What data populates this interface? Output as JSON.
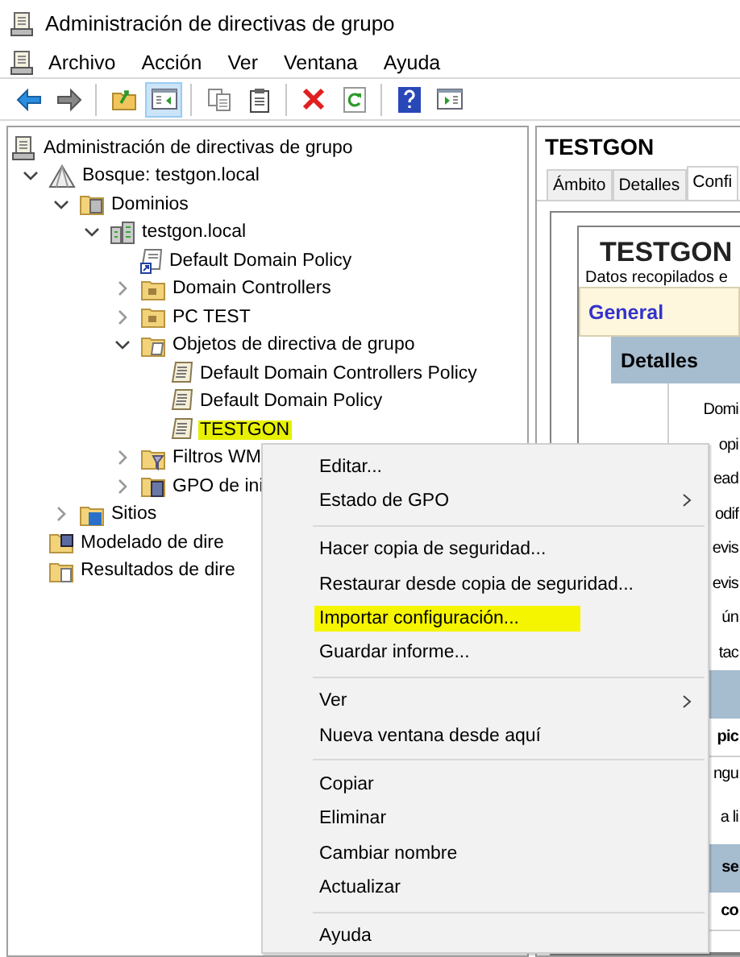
{
  "window": {
    "title": "Administración de directivas de grupo"
  },
  "menu_bar": [
    "Archivo",
    "Acción",
    "Ver",
    "Ventana",
    "Ayuda"
  ],
  "toolbar": [
    {
      "kind": "back",
      "pressed": false
    },
    {
      "kind": "forward",
      "pressed": false
    },
    {
      "kind": "separator"
    },
    {
      "kind": "up-folder",
      "pressed": false
    },
    {
      "kind": "tree-pane",
      "pressed": true
    },
    {
      "kind": "separator"
    },
    {
      "kind": "copy",
      "pressed": false
    },
    {
      "kind": "paste",
      "pressed": false
    },
    {
      "kind": "separator"
    },
    {
      "kind": "delete",
      "pressed": false
    },
    {
      "kind": "refresh",
      "pressed": false
    },
    {
      "kind": "separator"
    },
    {
      "kind": "help",
      "pressed": false
    },
    {
      "kind": "panel",
      "pressed": false
    }
  ],
  "tree": [
    {
      "label": "Administración de directivas de grupo",
      "kind": "console",
      "highlighted": false,
      "children": [
        {
          "label": "Bosque: testgon.local",
          "kind": "forest",
          "expanded": true,
          "highlighted": false,
          "children": [
            {
              "label": "Dominios",
              "kind": "domains",
              "expanded": true,
              "highlighted": false,
              "children": [
                {
                  "label": "testgon.local",
                  "kind": "domain",
                  "expanded": true,
                  "highlighted": false,
                  "children": [
                    {
                      "label": "Default Domain Policy",
                      "kind": "gpo-link",
                      "highlighted": false
                    },
                    {
                      "label": "Domain Controllers",
                      "kind": "ou",
                      "expanded": false,
                      "highlighted": false
                    },
                    {
                      "label": "PC TEST",
                      "kind": "ou",
                      "expanded": false,
                      "highlighted": false
                    },
                    {
                      "label": "Objetos de directiva de grupo",
                      "kind": "gpo-folder",
                      "expanded": true,
                      "highlighted": false,
                      "children": [
                        {
                          "label": "Default Domain Controllers Policy",
                          "kind": "gpo",
                          "highlighted": false
                        },
                        {
                          "label": "Default Domain Policy",
                          "kind": "gpo",
                          "highlighted": false
                        },
                        {
                          "label": "TESTGON",
                          "kind": "gpo",
                          "highlighted": true
                        }
                      ]
                    },
                    {
                      "label": "Filtros WM",
                      "kind": "wmi",
                      "expanded": false,
                      "highlighted": false
                    },
                    {
                      "label": "GPO de ini",
                      "kind": "starter",
                      "expanded": false,
                      "highlighted": false
                    }
                  ]
                }
              ]
            },
            {
              "label": "Sitios",
              "kind": "sites",
              "expanded": false,
              "highlighted": false
            }
          ]
        },
        {
          "label": "Modelado de dire",
          "kind": "modeling",
          "highlighted": false
        },
        {
          "label": "Resultados de dire",
          "kind": "results",
          "highlighted": false
        }
      ]
    }
  ],
  "details_pane": {
    "title": "TESTGON",
    "tabs": [
      {
        "label": "Ámbito",
        "selected": false
      },
      {
        "label": "Detalles",
        "selected": false
      },
      {
        "label": "Confi",
        "selected": true
      }
    ],
    "report": {
      "title": "TESTGON",
      "subtitle": "Datos recopilados e",
      "section": "General",
      "subsection": "Detalles",
      "rows": [
        {
          "kind": "row",
          "text": "Domi"
        },
        {
          "kind": "row",
          "text": "opi"
        },
        {
          "kind": "row",
          "text": "ead"
        },
        {
          "kind": "row",
          "text": "odif"
        },
        {
          "kind": "row",
          "text": "evis"
        },
        {
          "kind": "row",
          "text": "evis"
        },
        {
          "kind": "row",
          "text": "ún"
        },
        {
          "kind": "row",
          "text": "tac"
        },
        {
          "kind": "band"
        },
        {
          "kind": "bold-row",
          "text": "pic"
        },
        {
          "kind": "row",
          "text": "ngu"
        },
        {
          "kind": "tall-row",
          "text": "a li"
        },
        {
          "kind": "band",
          "text": "se"
        },
        {
          "kind": "bold-row",
          "text": "co"
        }
      ]
    }
  },
  "context_menu": [
    {
      "kind": "item",
      "label": "Editar...",
      "submenu": false,
      "highlighted": false
    },
    {
      "kind": "item",
      "label": "Estado de GPO",
      "submenu": true,
      "highlighted": false
    },
    {
      "kind": "separator"
    },
    {
      "kind": "item",
      "label": "Hacer copia de seguridad...",
      "submenu": false,
      "highlighted": false
    },
    {
      "kind": "item",
      "label": "Restaurar desde copia de seguridad...",
      "submenu": false,
      "highlighted": false
    },
    {
      "kind": "item",
      "label": "Importar configuración...",
      "submenu": false,
      "highlighted": true
    },
    {
      "kind": "item",
      "label": "Guardar informe...",
      "submenu": false,
      "highlighted": false
    },
    {
      "kind": "separator"
    },
    {
      "kind": "item",
      "label": "Ver",
      "submenu": true,
      "highlighted": false
    },
    {
      "kind": "item",
      "label": "Nueva ventana desde aquí",
      "submenu": false,
      "highlighted": false
    },
    {
      "kind": "separator"
    },
    {
      "kind": "item",
      "label": "Copiar",
      "submenu": false,
      "highlighted": false
    },
    {
      "kind": "item",
      "label": "Eliminar",
      "submenu": false,
      "highlighted": false
    },
    {
      "kind": "item",
      "label": "Cambiar nombre",
      "submenu": false,
      "highlighted": false
    },
    {
      "kind": "item",
      "label": "Actualizar",
      "submenu": false,
      "highlighted": false
    },
    {
      "kind": "separator"
    },
    {
      "kind": "item",
      "label": "Ayuda",
      "submenu": false,
      "highlighted": false
    }
  ]
}
